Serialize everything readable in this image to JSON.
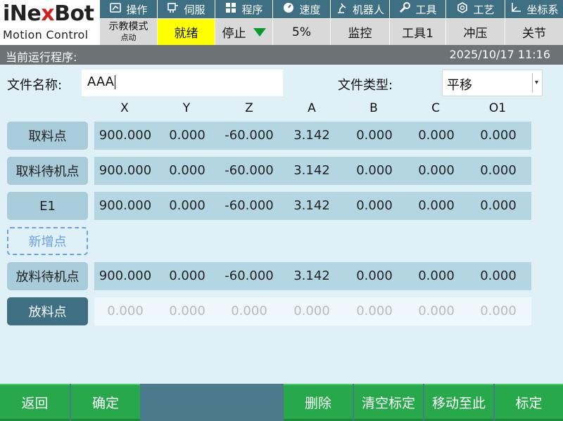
{
  "logo": {
    "brand_prefix": "iNe",
    "brand_x": "x",
    "brand_suffix": "Bot",
    "subtitle": "Motion Control"
  },
  "top_menu": [
    {
      "label": "操作",
      "icon": "robot-arm-icon"
    },
    {
      "label": "伺服",
      "icon": "servo-icon"
    },
    {
      "label": "程序",
      "icon": "grid-icon"
    },
    {
      "label": "速度",
      "icon": "speedometer-icon"
    },
    {
      "label": "机器人",
      "icon": "robot-icon"
    },
    {
      "label": "工具",
      "icon": "wrench-icon"
    },
    {
      "label": "工艺",
      "icon": "process-icon"
    },
    {
      "label": "坐标系",
      "icon": "axes-icon"
    }
  ],
  "status": {
    "mode_main": "示教模式",
    "mode_sub": "点动",
    "ready": "就绪",
    "stop": "停止",
    "speed": "5%",
    "monitor": "监控",
    "tool": "工具1",
    "process": "冲压",
    "coord": "关节"
  },
  "titlebar": {
    "left": "当前运行程序:",
    "datetime": "2025/10/17 11:16"
  },
  "file": {
    "name_label": "文件名称:",
    "name_value": "AAA",
    "type_label": "文件类型:",
    "type_value": "平移"
  },
  "columns": [
    "X",
    "Y",
    "Z",
    "A",
    "B",
    "C",
    "O1"
  ],
  "rows": [
    {
      "name": "取料点",
      "style": "normal",
      "values": [
        "900.000",
        "0.000",
        "-60.000",
        "3.142",
        "0.000",
        "0.000",
        "0.000"
      ]
    },
    {
      "name": "取料待机点",
      "style": "normal",
      "values": [
        "900.000",
        "0.000",
        "-60.000",
        "3.142",
        "0.000",
        "0.000",
        "0.000"
      ]
    },
    {
      "name": "E1",
      "style": "normal",
      "values": [
        "900.000",
        "0.000",
        "-60.000",
        "3.142",
        "0.000",
        "0.000",
        "0.000"
      ]
    },
    {
      "name": "新增点",
      "style": "add",
      "values": []
    },
    {
      "name": "放料待机点",
      "style": "normal",
      "values": [
        "900.000",
        "0.000",
        "-60.000",
        "3.142",
        "0.000",
        "0.000",
        "0.000"
      ]
    },
    {
      "name": "放料点",
      "style": "dark",
      "values": [
        "0.000",
        "0.000",
        "0.000",
        "0.000",
        "0.000",
        "0.000",
        "0.000"
      ]
    }
  ],
  "footer": {
    "back": "返回",
    "confirm": "确定",
    "delete": "删除",
    "clear_calib": "清空标定",
    "move_to": "移动至此",
    "calibrate": "标定"
  },
  "colors": {
    "accent": "#3e6f83",
    "ready": "#ffff00",
    "footer_button": "#27a84b",
    "stop_triangle": "#0a9a2a"
  }
}
